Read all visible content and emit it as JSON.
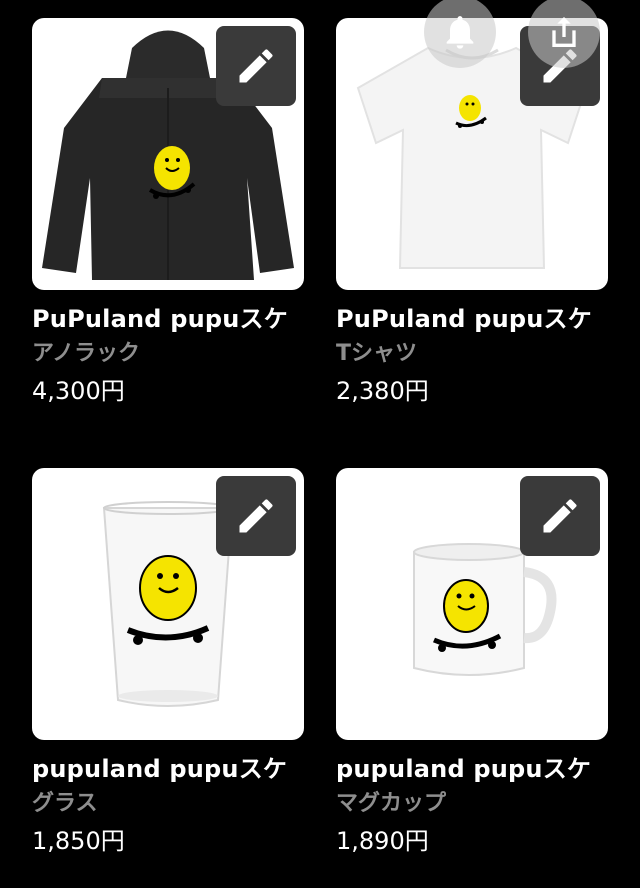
{
  "products": [
    {
      "title": "PuPuland  pupuスケ",
      "category": "アノラック",
      "price": "4,300円",
      "image": "black-anorak-with-skating-character"
    },
    {
      "title": "PuPuland  pupuスケ",
      "category": "Tシャツ",
      "price": "2,380円",
      "image": "white-tshirt-with-skating-character"
    },
    {
      "title": "pupuland   pupuスケ",
      "category": "グラス",
      "price": "1,850円",
      "image": "drinking-glass-with-skating-character"
    },
    {
      "title": "pupuland   pupuスケ",
      "category": "マグカップ",
      "price": "1,890円",
      "image": "mug-with-skating-character"
    }
  ],
  "icons": {
    "edit": "pencil-icon",
    "notify": "bell-icon",
    "share": "share-icon"
  },
  "colors": {
    "background": "#000000",
    "category_text": "#8e8e8e",
    "edit_button": "#3a3a3a",
    "character": "#f5e400"
  }
}
